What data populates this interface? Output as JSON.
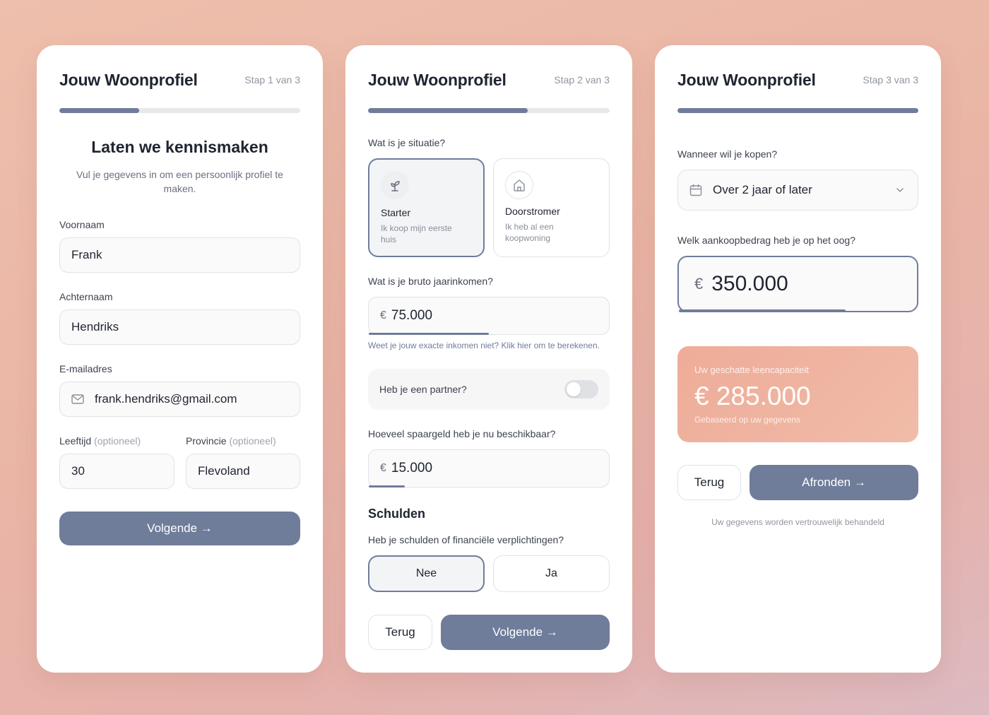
{
  "card1": {
    "title": "Jouw Woonprofiel",
    "step": "Stap 1 van 3",
    "progress": 0.33,
    "heading": "Laten we kennismaken",
    "subtitle": "Vul je gegevens in om een persoonlijk profiel te maken.",
    "first_name_label": "Voornaam",
    "first_name_value": "Frank",
    "last_name_label": "Achternaam",
    "last_name_value": "Hendriks",
    "email_label": "E-mailadres",
    "email_value": "frank.hendriks@gmail.com",
    "age_label": "Leeftijd",
    "age_optional": "(optioneel)",
    "age_value": "30",
    "province_label": "Provincie",
    "province_optional": "(optioneel)",
    "province_value": "Flevoland",
    "next_button": "Volgende →"
  },
  "card2": {
    "title": "Jouw Woonprofiel",
    "step": "Stap 2 van 3",
    "progress": 0.66,
    "situation_question": "Wat is je situatie?",
    "options": [
      {
        "name": "Starter",
        "desc": "Ik koop mijn eerste huis",
        "selected": true,
        "icon": "sprout-icon"
      },
      {
        "name": "Doorstromer",
        "desc": "Ik heb al een koopwoning",
        "selected": false,
        "icon": "house-icon"
      }
    ],
    "income_question": "Wat is je bruto jaarinkomen?",
    "currency": "€",
    "income_value": "75.000",
    "income_fill": 0.5,
    "income_hint": "Weet je jouw exacte inkomen niet? Klik hier om te berekenen.",
    "partner_label": "Heb je een partner?",
    "partner_on": false,
    "savings_question": "Hoeveel spaargeld heb je nu beschikbaar?",
    "savings_value": "15.000",
    "savings_fill": 0.15,
    "debts_heading": "Schulden",
    "debts_question": "Heb je schulden of financiële verplichtingen?",
    "debts_no": "Nee",
    "debts_yes": "Ja",
    "back_button": "Terug",
    "next_button": "Volgende →"
  },
  "card3": {
    "title": "Jouw Woonprofiel",
    "step": "Stap 3 van 3",
    "progress": 1.0,
    "when_question": "Wanneer wil je kopen?",
    "when_value": "Over 2 jaar of later",
    "amount_question": "Welk aankoopbedrag heb je op het oog?",
    "currency": "€",
    "amount_value": "350.000",
    "amount_fill": 0.7,
    "capacity_label": "Uw geschatte leencapaciteit",
    "capacity_value": "€ 285.000",
    "capacity_note": "Gebaseerd op uw gegevens",
    "back_button": "Terug",
    "finish_button": "Afronden →",
    "privacy_note": "Uw gegevens worden vertrouwelijk behandeld"
  },
  "colors": {
    "accent": "#6f7c9a",
    "capacity_bg": "#eeb19e",
    "background": "#eebfac"
  }
}
